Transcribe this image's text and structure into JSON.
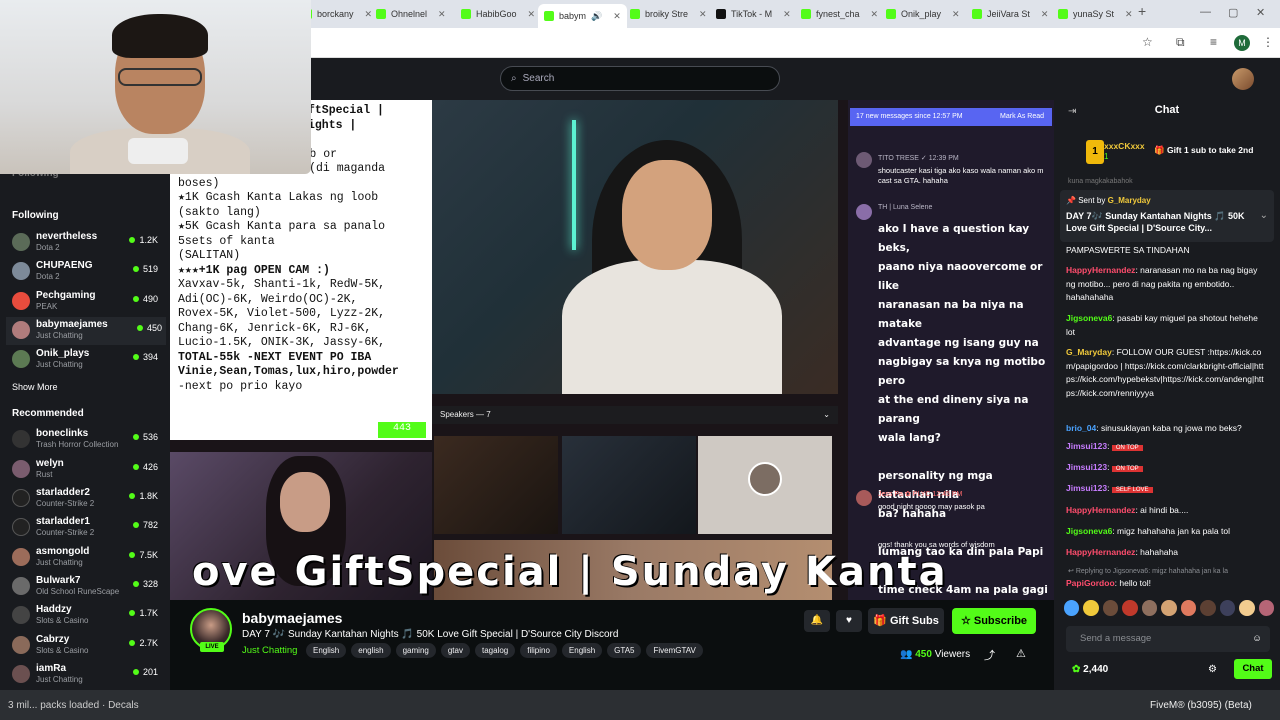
{
  "browser": {
    "tabs": [
      {
        "label": "borckany",
        "active": false
      },
      {
        "label": "Ohnelnel",
        "active": false
      },
      {
        "label": "HabibGoo",
        "active": false
      },
      {
        "label": "babym",
        "active": true
      },
      {
        "label": "broiky Stre",
        "active": false
      },
      {
        "label": "TikTok - M",
        "active": false
      },
      {
        "label": "fynest_cha",
        "active": false
      },
      {
        "label": "Onik_play",
        "active": false
      },
      {
        "label": "JeiiVara St",
        "active": false
      },
      {
        "label": "yunaSy St",
        "active": false
      }
    ],
    "new_tab": "+",
    "profile_initial": "M"
  },
  "header": {
    "search_placeholder": "Search"
  },
  "sidebar": {
    "following_label": "Following",
    "following": [
      {
        "name": "nevertheless",
        "sub": "Dota 2",
        "count": "1.2K",
        "color": "#5b6b58"
      },
      {
        "name": "CHUPAENG",
        "sub": "Dota 2",
        "count": "519",
        "color": "#7d8a99"
      },
      {
        "name": "Pechgaming",
        "sub": "PEAK",
        "count": "490",
        "color": "#e84c3d"
      },
      {
        "name": "babymaejames",
        "sub": "Just Chatting",
        "count": "450",
        "color": "#b07c7c"
      },
      {
        "name": "Onik_plays",
        "sub": "Just Chatting",
        "count": "394",
        "color": "#5c7a53"
      }
    ],
    "show_more": "Show More",
    "recommended_label": "Recommended",
    "recommended": [
      {
        "name": "boneclinks",
        "sub": "Trash Horror Collection",
        "count": "536",
        "color": "#333"
      },
      {
        "name": "welyn",
        "sub": "Rust",
        "count": "426",
        "color": "#7a5c6e"
      },
      {
        "name": "starladder2",
        "sub": "Counter-Strike 2",
        "count": "1.8K",
        "color": "#222"
      },
      {
        "name": "starladder1",
        "sub": "Counter-Strike 2",
        "count": "782",
        "color": "#222"
      },
      {
        "name": "asmongold",
        "sub": "Just Chatting",
        "count": "7.5K",
        "color": "#9c6c5a"
      },
      {
        "name": "Bulwark7",
        "sub": "Old School RuneScape",
        "count": "328",
        "color": "#6a6a6a"
      },
      {
        "name": "Haddzy",
        "sub": "Slots & Casino",
        "count": "1.7K",
        "color": "#444"
      },
      {
        "name": "Cabrzy",
        "sub": "Slots & Casino",
        "count": "2.7K",
        "color": "#8a6a5a"
      },
      {
        "name": "iamRa",
        "sub": "Just Chatting",
        "count": "201",
        "color": "#6b5050"
      }
    ],
    "hidden_label": "Following"
  },
  "overlay": {
    "note_lines": [
      "ftSpecial |",
      "ights |",
      "",
      "as Loob or",
      "Kapal MUKHA hahaha (di maganda",
      "boses)",
      "★1K Gcash Kanta Lakas ng loob",
      "(sakto lang)",
      "★5K Gcash Kanta para sa panalo",
      "5sets of kanta",
      "(SALITAN)",
      "★★★+1K pag OPEN CAM :)",
      "Xavxav-5k, Shanti-1k, RedW-5K,",
      "Adi(OC)-6K, Weirdo(OC)-2K,",
      "Rovex-5K, Violet-500, Lyzz-2K,",
      "Chang-6K, Jenrick-6K, RJ-6K,",
      "Lucio-1.5K, ONIK-3K, Jassy-6K,",
      "TOTAL-55k  -NEXT EVENT PO IBA",
      "Vinie,Sean,Tomas,lux,hiro,powder",
      "-next po prio kayo"
    ],
    "note_counter": "443",
    "speakers": "Speakers — 7",
    "chat_bar_left": "17 new messages since 12:57 PM",
    "chat_bar_right": "Mark As Read",
    "chat_1_name": "TITO TRESE ✓ 12:39 PM",
    "chat_1_text": "shoutcaster kasi tiga ako kaso wala naman ako m cast sa GTA. hahaha",
    "chat_2_name": "TH | Luna Selene",
    "chat_2_lines": [
      "ako I have a question kay beks,",
      "paano niya naoovercome or like",
      "naranasan na ba niya na matake",
      "advantage ng isang guy na",
      "nagbigay sa knya ng motibo pero",
      "at the end dineny siya na parang",
      "wala lang?",
      "",
      "personality ng mga katauhan nila",
      "ba? hahaha",
      "",
      "lumang tao ka din pala Papi",
      "",
      "time check 4am na pala gagi"
    ],
    "chat_3_name": "Jess Pa ✿ PLYC 12:45 PM",
    "chat_3_text": "good night poooo may pasok pa",
    "chat_4_text": "ggs! thank you sa words of wisdom",
    "marquee": "ove GiftSpecial | Sunday Kanta"
  },
  "channel": {
    "name": "babymaejames",
    "live": "LIVE",
    "title": "DAY 7 🎶 Sunday Kantahan Nights 🎵 50K Love Gift Special | D'Source City Discord",
    "category": "Just Chatting",
    "tags": [
      "English",
      "english",
      "gaming",
      "gtav",
      "tagalog",
      "filipino",
      "English",
      "GTA5",
      "FivemGTAV"
    ],
    "gift_subs": "Gift Subs",
    "subscribe": "Subscribe",
    "viewers": "450",
    "viewers_label": "Viewers"
  },
  "chat": {
    "title": "Chat",
    "gift_rank": "1",
    "gift_user": "xxxCKxxx",
    "gift_count": "1",
    "gift_cta": "Gift 1 sub to take 2nd",
    "scrolled_text": "kuna magkakabahok",
    "pinned_by": "Sent by",
    "pinned_user": "G_Maryday",
    "pinned_text": "DAY 7🎶 Sunday Kantahan Nights 🎵 50K Love Gift Special | D'Source City...",
    "messages": [
      {
        "user": "",
        "text": "PAMPASWERTE SA TINDAHAN",
        "color": "#fff"
      },
      {
        "user": "HappyHernandez",
        "text": ": naranasan mo na ba nag bigay ng motibo... pero di nag pakita ng embotido.. hahahahaha",
        "color": "#ff4d6d"
      },
      {
        "user": "Jigsoneva6",
        "text": ": pasabi kay miguel pa shotout hehehe lot",
        "color": "#53fc18"
      },
      {
        "user": "G_Maryday",
        "text": ": FOLLOW OUR GUEST :https://kick.com/papigordoo | https://kick.com/clarkbright-official|https://kick.com/hypebekstv|https://kick.com/andeng|https://kick.com/renniyyya",
        "color": "#f0c93b"
      },
      {
        "user": "brio_04",
        "text": ": sinusuklayan kaba ng jowa mo beks?",
        "color": "#4aa3ff"
      },
      {
        "user": "Jimsui123",
        "text": ": ",
        "color": "#c77dff"
      },
      {
        "user": "Jimsui123",
        "text": ": ",
        "color": "#c77dff"
      },
      {
        "user": "Jimsui123",
        "text": ": ",
        "color": "#c77dff"
      },
      {
        "user": "HappyHernandez",
        "text": ": ai hindi ba....",
        "color": "#ff4d6d"
      },
      {
        "user": "Jigsoneva6",
        "text": ": migz hahahaha jan ka pala tol",
        "color": "#53fc18"
      },
      {
        "user": "HappyHernandez",
        "text": ": hahahaha",
        "color": "#ff4d6d"
      }
    ],
    "reply_hint": "Replying to Jigsoneva6: migz hahahaha jan ka la",
    "last_user": "PapiGordoo",
    "last_text": ": hello tol!",
    "send_placeholder": "Send a message",
    "points": "2,440",
    "chat_button": "Chat"
  },
  "taskbar": {
    "left": "3 mil... packs loaded",
    "decals": "Decals",
    "right": "FiveM® (b3095) (Beta)"
  },
  "colors": {
    "accent": "#53fc18",
    "bg": "#0b0e0f",
    "panel": "#191b1f"
  }
}
